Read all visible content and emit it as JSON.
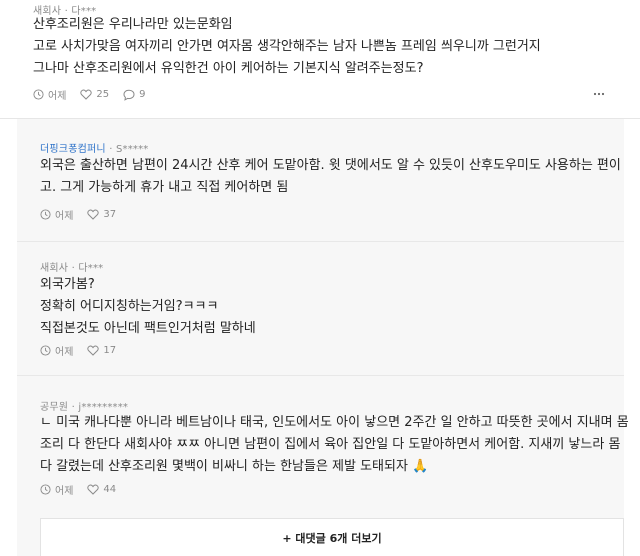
{
  "top_comment": {
    "company": "새회사",
    "separator": " · ",
    "user": "다***",
    "lines": [
      "산후조리원은 우리나라만 있는문화임",
      "고로 사치가맞음 여자끼리 안가면 여자몸 생각안해주는 남자 나쁜놈 프레임 씌우니까 그런거지",
      "그나마 산후조리원에서 유익한건 아이 케어하는 기본지식 알려주는정도?"
    ],
    "time": "어제",
    "likes": "25",
    "replies": "9"
  },
  "replies": [
    {
      "company": "더핑크퐁컴퍼니",
      "separator": " · ",
      "user": "S*****",
      "lines": [
        "외국은 출산하면 남편이 24시간 산후 케어 도맡아함. 윗 댓에서도 알 수 있듯이 산후도우미도 사용하는 편이",
        "고. 그게 가능하게 휴가 내고 직접 케어하면 됨"
      ],
      "time": "어제",
      "likes": "37"
    },
    {
      "company": "새회사",
      "separator": " · ",
      "user": "다***",
      "lines": [
        "외국가봄?",
        "정확히 어디지칭하는거임?ㅋㅋㅋ",
        "직접본것도 아닌데 팩트인거처럼 말하네"
      ],
      "time": "어제",
      "likes": "17"
    },
    {
      "company": "공무원",
      "separator": " · ",
      "user": "j*********",
      "lines": [
        "ㄴ 미국 캐나다뿐 아니라 베트남이나 태국, 인도에서도 아이 낳으면 2주간 일 안하고 따뜻한 곳에서 지내며 몸",
        "조리 다 한단다 새회사야 ㅉㅉ 아니면 남편이 집에서 육아 집안일 다 도맡아하면서 케어함. 지새끼 낳느라 몸",
        "다 갈렸는데 산후조리원 몇백이 비싸니 하는 한남들은 제발 도태되자 🙏"
      ],
      "time": "어제",
      "likes": "44"
    }
  ],
  "more_replies_label": "+ 대댓글 6개 더보기",
  "colors": {
    "company_highlight": "#2e73c9",
    "reply_background": "#f7f7f7"
  }
}
